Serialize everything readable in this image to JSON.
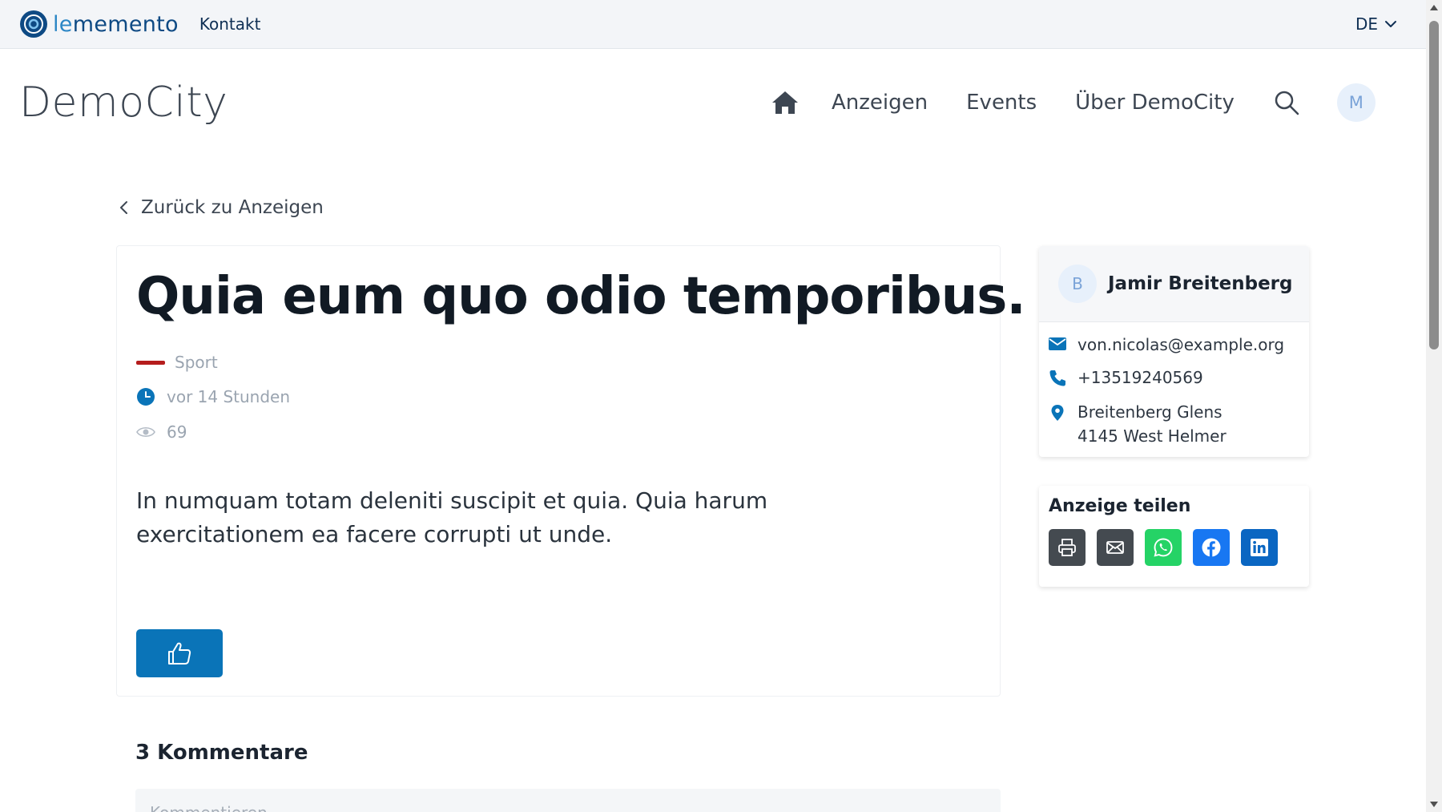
{
  "topbar": {
    "brand_prefix": "le",
    "brand_suffix": "memento",
    "contact_link": "Kontakt",
    "language": "DE"
  },
  "site": {
    "title": "DemoCity"
  },
  "nav": {
    "items": [
      {
        "label": "Anzeigen"
      },
      {
        "label": "Events"
      },
      {
        "label": "Über DemoCity"
      }
    ],
    "user_initial": "M"
  },
  "back_link": "Zurück zu Anzeigen",
  "ad": {
    "title": "Quia eum quo odio temporibus.",
    "category": "Sport",
    "category_color": "#b51d1d",
    "time": "vor 14 Stunden",
    "views": "69",
    "description": "In numquam totam deleniti suscipit et quia. Quia harum exercitationem ea facere corrupti ut unde."
  },
  "contact": {
    "initial": "B",
    "name": "Jamir Breitenberg",
    "email": "von.nicolas@example.org",
    "phone": "+13519240569",
    "address_line1": "Breitenberg Glens",
    "address_line2": "4145 West Helmer"
  },
  "share": {
    "title": "Anzeige teilen",
    "buttons": [
      {
        "icon": "printer-icon",
        "color": "#444a50"
      },
      {
        "icon": "mail-icon",
        "color": "#444a50"
      },
      {
        "icon": "whatsapp-icon",
        "color": "#25d366"
      },
      {
        "icon": "facebook-icon",
        "color": "#1877f2"
      },
      {
        "icon": "linkedin-icon",
        "color": "#0a66c2"
      }
    ]
  },
  "comments": {
    "title": "3 Kommentare",
    "placeholder": "Kommentieren"
  },
  "colors": {
    "accent": "#0a74b8",
    "brand": "#0e4a84"
  }
}
